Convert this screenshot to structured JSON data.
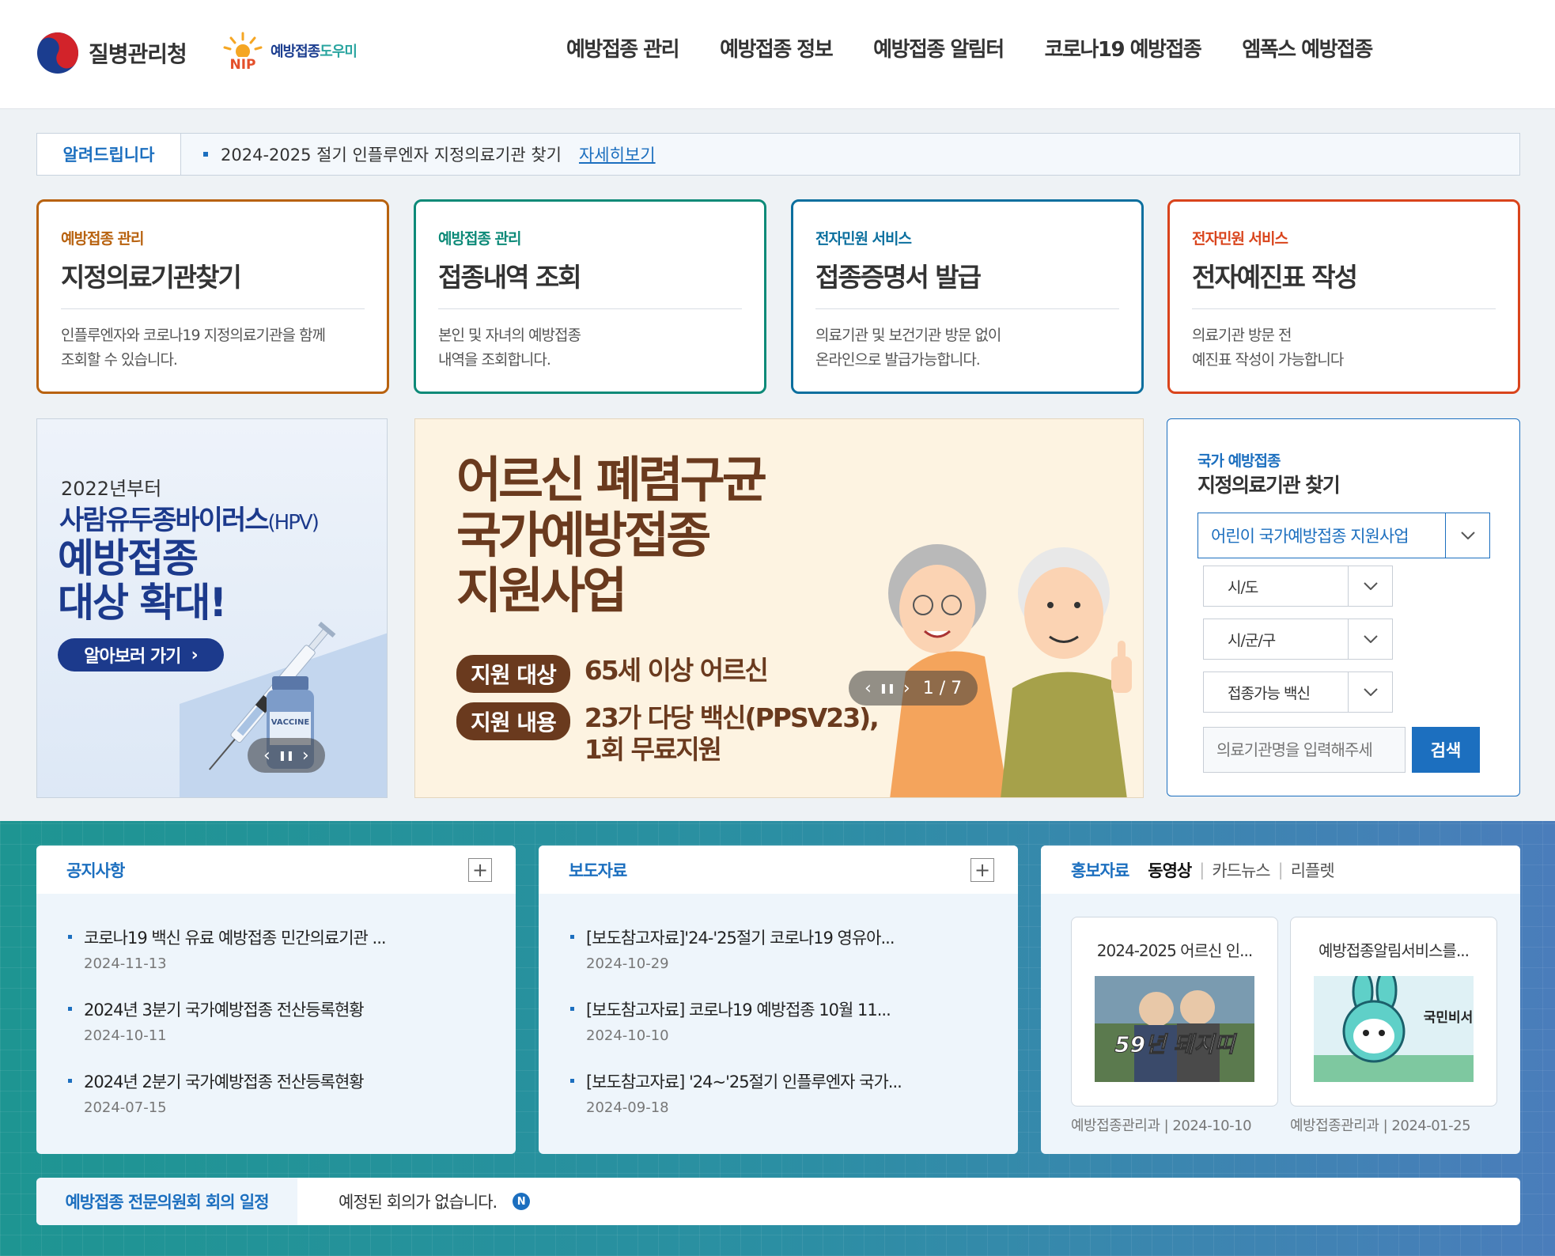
{
  "header": {
    "agency_name": "질병관리청",
    "nip_logo_text": "NIP",
    "nip_name_main": "예방접종",
    "nip_name_accent": "도우미",
    "nav": [
      "예방접종 관리",
      "예방접종 정보",
      "예방접종 알림터",
      "코로나19 예방접종",
      "엠폭스 예방접종"
    ]
  },
  "notice": {
    "label": "알려드립니다",
    "text": "2024-2025 절기 인플루엔자 지정의료기관 찾기",
    "link": "자세히보기"
  },
  "service_cards": [
    {
      "category": "예방접종 관리",
      "title": "지정의료기관찾기",
      "desc": "인플루엔자와 코로나19 지정의료기관을 함께\n조회할 수 있습니다.",
      "color": "#b8620f"
    },
    {
      "category": "예방접종 관리",
      "title": "접종내역 조회",
      "desc": "본인 및 자녀의 예방접종\n내역을 조회합니다.",
      "color": "#0d8a78"
    },
    {
      "category": "전자민원 서비스",
      "title": "접종증명서 발급",
      "desc": "의료기관 및 보건기관 방문 없이\n온라인으로 발급가능합니다.",
      "color": "#0b6f9e"
    },
    {
      "category": "전자민원 서비스",
      "title": "전자예진표 작성",
      "desc": "의료기관 방문 전\n예진표 작성이 가능합니다",
      "color": "#d9441c"
    }
  ],
  "hpv_banner": {
    "year": "2022년부터",
    "line1": "사람유두종바이러스",
    "line1_suffix": "(HPV)",
    "line2": "예방접종",
    "line3": "대상 확대!",
    "button": "알아보러 가기",
    "vial_label": "VACCINE",
    "prev": "‹",
    "pause": "❚❚",
    "next": "›"
  },
  "pneumo_banner": {
    "title_l1": "어르신 폐렴구균",
    "title_l2": "국가예방접종",
    "title_l3": "지원사업",
    "target_tag": "지원 대상",
    "target_value": "65세 이상 어르신",
    "content_tag": "지원 내용",
    "content_value": "23가 다당 백신(PPSV23),\n1회 무료지원",
    "prev": "‹",
    "pause": "❚❚",
    "next": "›",
    "counter": "1 / 7"
  },
  "finder": {
    "category": "국가 예방접종",
    "title": "지정의료기관 찾기",
    "program_select": "어린이 국가예방접종 지원사업",
    "sido_select": "시/도",
    "sigungu_select": "시/군/구",
    "vaccine_select": "접종가능 백신",
    "search_placeholder": "의료기관명을 입력해주세",
    "search_button": "검색"
  },
  "notices_board": {
    "title": "공지사항",
    "items": [
      {
        "title": "코로나19 백신 유료 예방접종 민간의료기관 ...",
        "date": "2024-11-13"
      },
      {
        "title": "2024년 3분기 국가예방접종 전산등록현황",
        "date": "2024-10-11"
      },
      {
        "title": "2024년 2분기 국가예방접종 전산등록현황",
        "date": "2024-07-15"
      }
    ]
  },
  "press_board": {
    "title": "보도자료",
    "items": [
      {
        "title": "[보도참고자료]'24-'25절기 코로나19 영유아...",
        "date": "2024-10-29"
      },
      {
        "title": "[보도참고자료] 코로나19 예방접종 10월 11...",
        "date": "2024-10-10"
      },
      {
        "title": "[보도참고자료] '24~'25절기 인플루엔자 국가...",
        "date": "2024-09-18"
      }
    ]
  },
  "promo_board": {
    "title": "홍보자료",
    "tabs": [
      "동영상",
      "카드뉴스",
      "리플렛"
    ],
    "cards": [
      {
        "title": "2024-2025 어르신 인...",
        "meta": "예방접종관리과 | 2024-10-10",
        "image_text": "59년 돼지띠"
      },
      {
        "title": "예방접종알림서비스를...",
        "meta": "예방접종관리과 | 2024-01-25",
        "image_text": "국민비서"
      }
    ]
  },
  "meeting": {
    "label": "예방접종 전문의원회 회의 일정",
    "text": "예정된 회의가 없습니다.",
    "badge": "N"
  },
  "colors": {
    "primary": "#1c6fbf",
    "navy": "#1c3a8c",
    "brown": "#6a3a1e"
  }
}
